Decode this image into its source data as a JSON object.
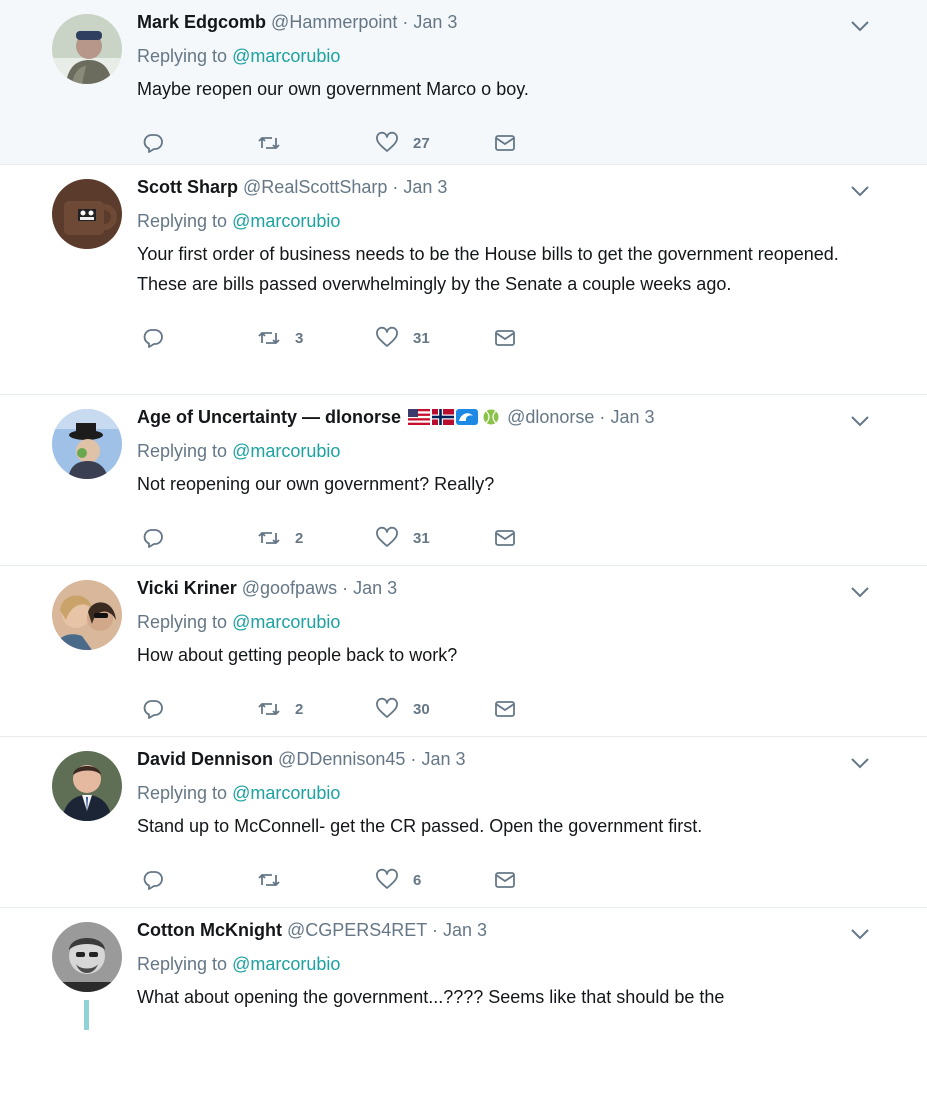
{
  "tweets": [
    {
      "fullname": "Mark Edgcomb",
      "handle": "@Hammerpoint",
      "time": "Jan 3",
      "replying_label": "Replying to",
      "replying_to": "@marcorubio",
      "text": "Maybe reopen our own government Marco o boy.",
      "retweets": "",
      "likes": "27",
      "highlight": true
    },
    {
      "fullname": "Scott Sharp",
      "handle": "@RealScottSharp",
      "time": "Jan 3",
      "replying_label": "Replying to",
      "replying_to": "@marcorubio",
      "text": "Your first order of business needs to be the House bills to get the government reopened. These are bills passed overwhelmingly by the Senate a couple weeks ago.",
      "retweets": "3",
      "likes": "31"
    },
    {
      "fullname": "Age of Uncertainty — dlonorse",
      "handle": "@dlonorse",
      "time": "Jan 3",
      "replying_label": "Replying to",
      "replying_to": "@marcorubio",
      "text": "Not reopening our own government? Really?",
      "retweets": "2",
      "likes": "31",
      "emoji": [
        "us-flag-emoji",
        "norway-flag-emoji",
        "wave-emoji",
        "tennis-ball-emoji"
      ]
    },
    {
      "fullname": "Vicki Kriner",
      "handle": "@goofpaws",
      "time": "Jan 3",
      "replying_label": "Replying to",
      "replying_to": "@marcorubio",
      "text": "How about getting people back to work?",
      "retweets": "2",
      "likes": "30"
    },
    {
      "fullname": "David Dennison",
      "handle": "@DDennison45",
      "time": "Jan 3",
      "replying_label": "Replying to",
      "replying_to": "@marcorubio",
      "text": "Stand up to McConnell- get the CR passed.  Open the government first.",
      "retweets": "",
      "likes": "6"
    },
    {
      "fullname": "Cotton McKnight",
      "handle": "@CGPERS4RET",
      "time": "Jan 3",
      "replying_label": "Replying to",
      "replying_to": "@marcorubio",
      "text": "What about opening the government...????  Seems like that should be the"
    }
  ],
  "separator": "·",
  "icons": {
    "reply": "reply-icon",
    "retweet": "retweet-icon",
    "like": "heart-icon",
    "dm": "envelope-icon",
    "menu": "chevron-down-icon"
  },
  "colors": {
    "accent": "#1da1a1",
    "muted": "#657786",
    "text": "#14171a",
    "highlight_bg": "#f5f8fa",
    "border": "#e6ecf0"
  }
}
